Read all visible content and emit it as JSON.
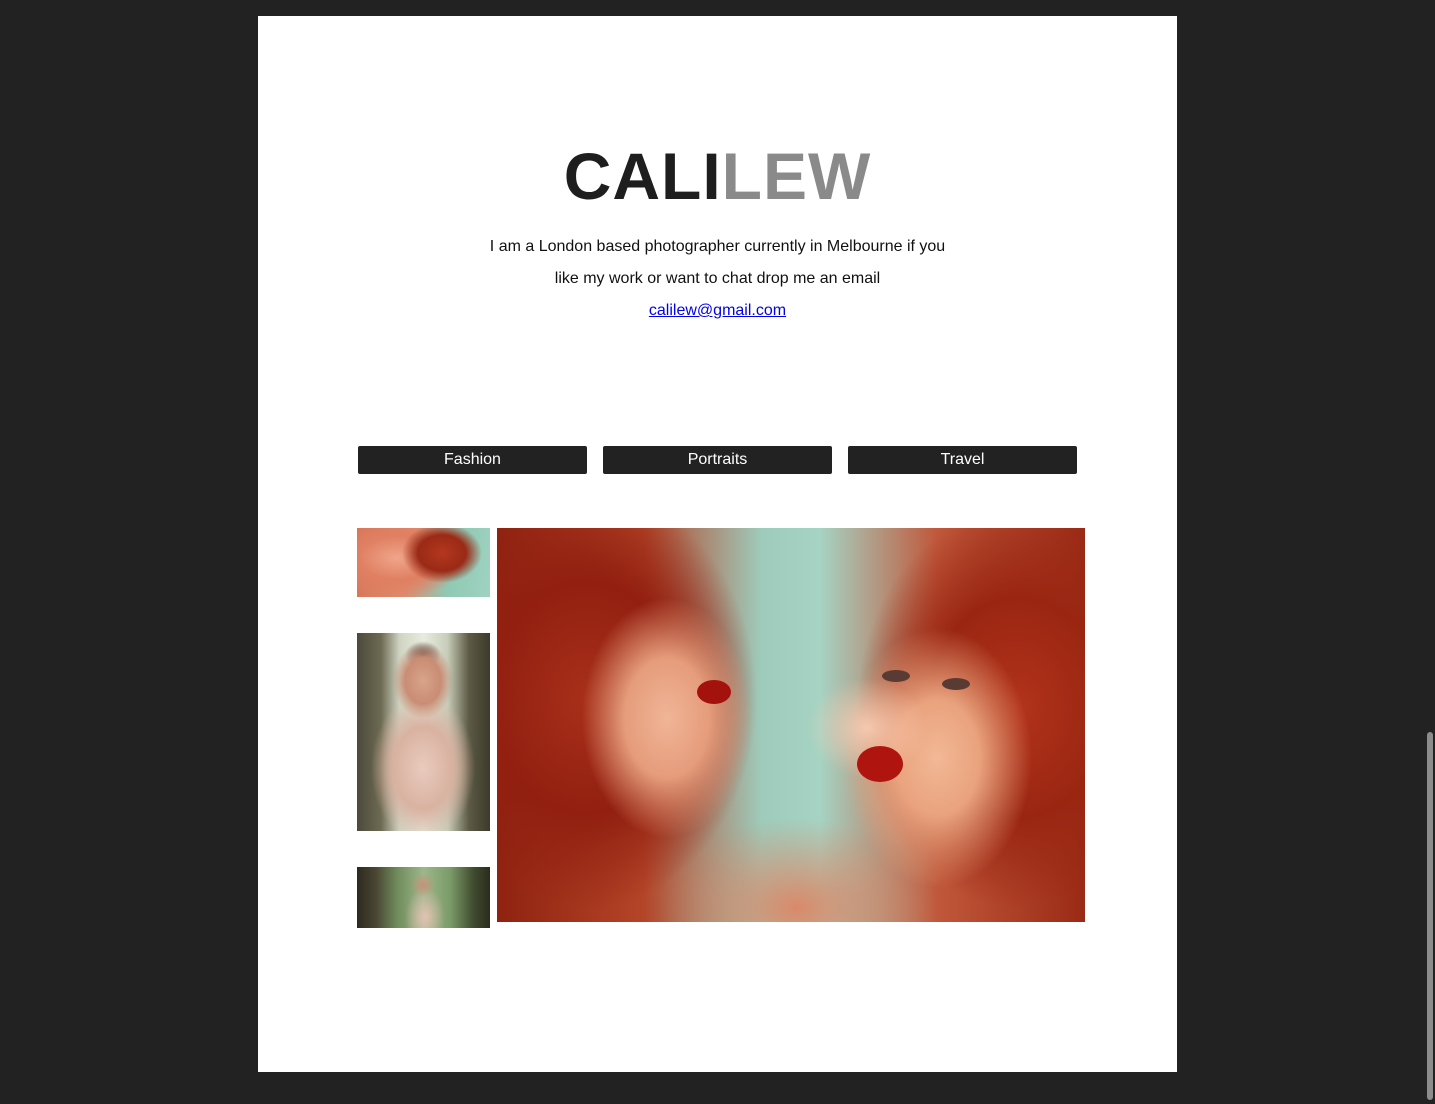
{
  "header": {
    "brand_first": "CALI",
    "brand_last": "LEW"
  },
  "intro": {
    "line1": "I am a London based photographer currently in Melbourne if you",
    "line2": "like my work or want to chat drop me an email",
    "email": "calilew@gmail.com"
  },
  "nav": {
    "items": [
      {
        "label": "Fashion"
      },
      {
        "label": "Portraits"
      },
      {
        "label": "Travel"
      }
    ]
  },
  "colors": {
    "background": "#222222",
    "page": "#ffffff",
    "brand_dark": "#1e1e1e",
    "brand_light": "#8a8a8a",
    "button": "#222222",
    "link": "#0000ee"
  }
}
